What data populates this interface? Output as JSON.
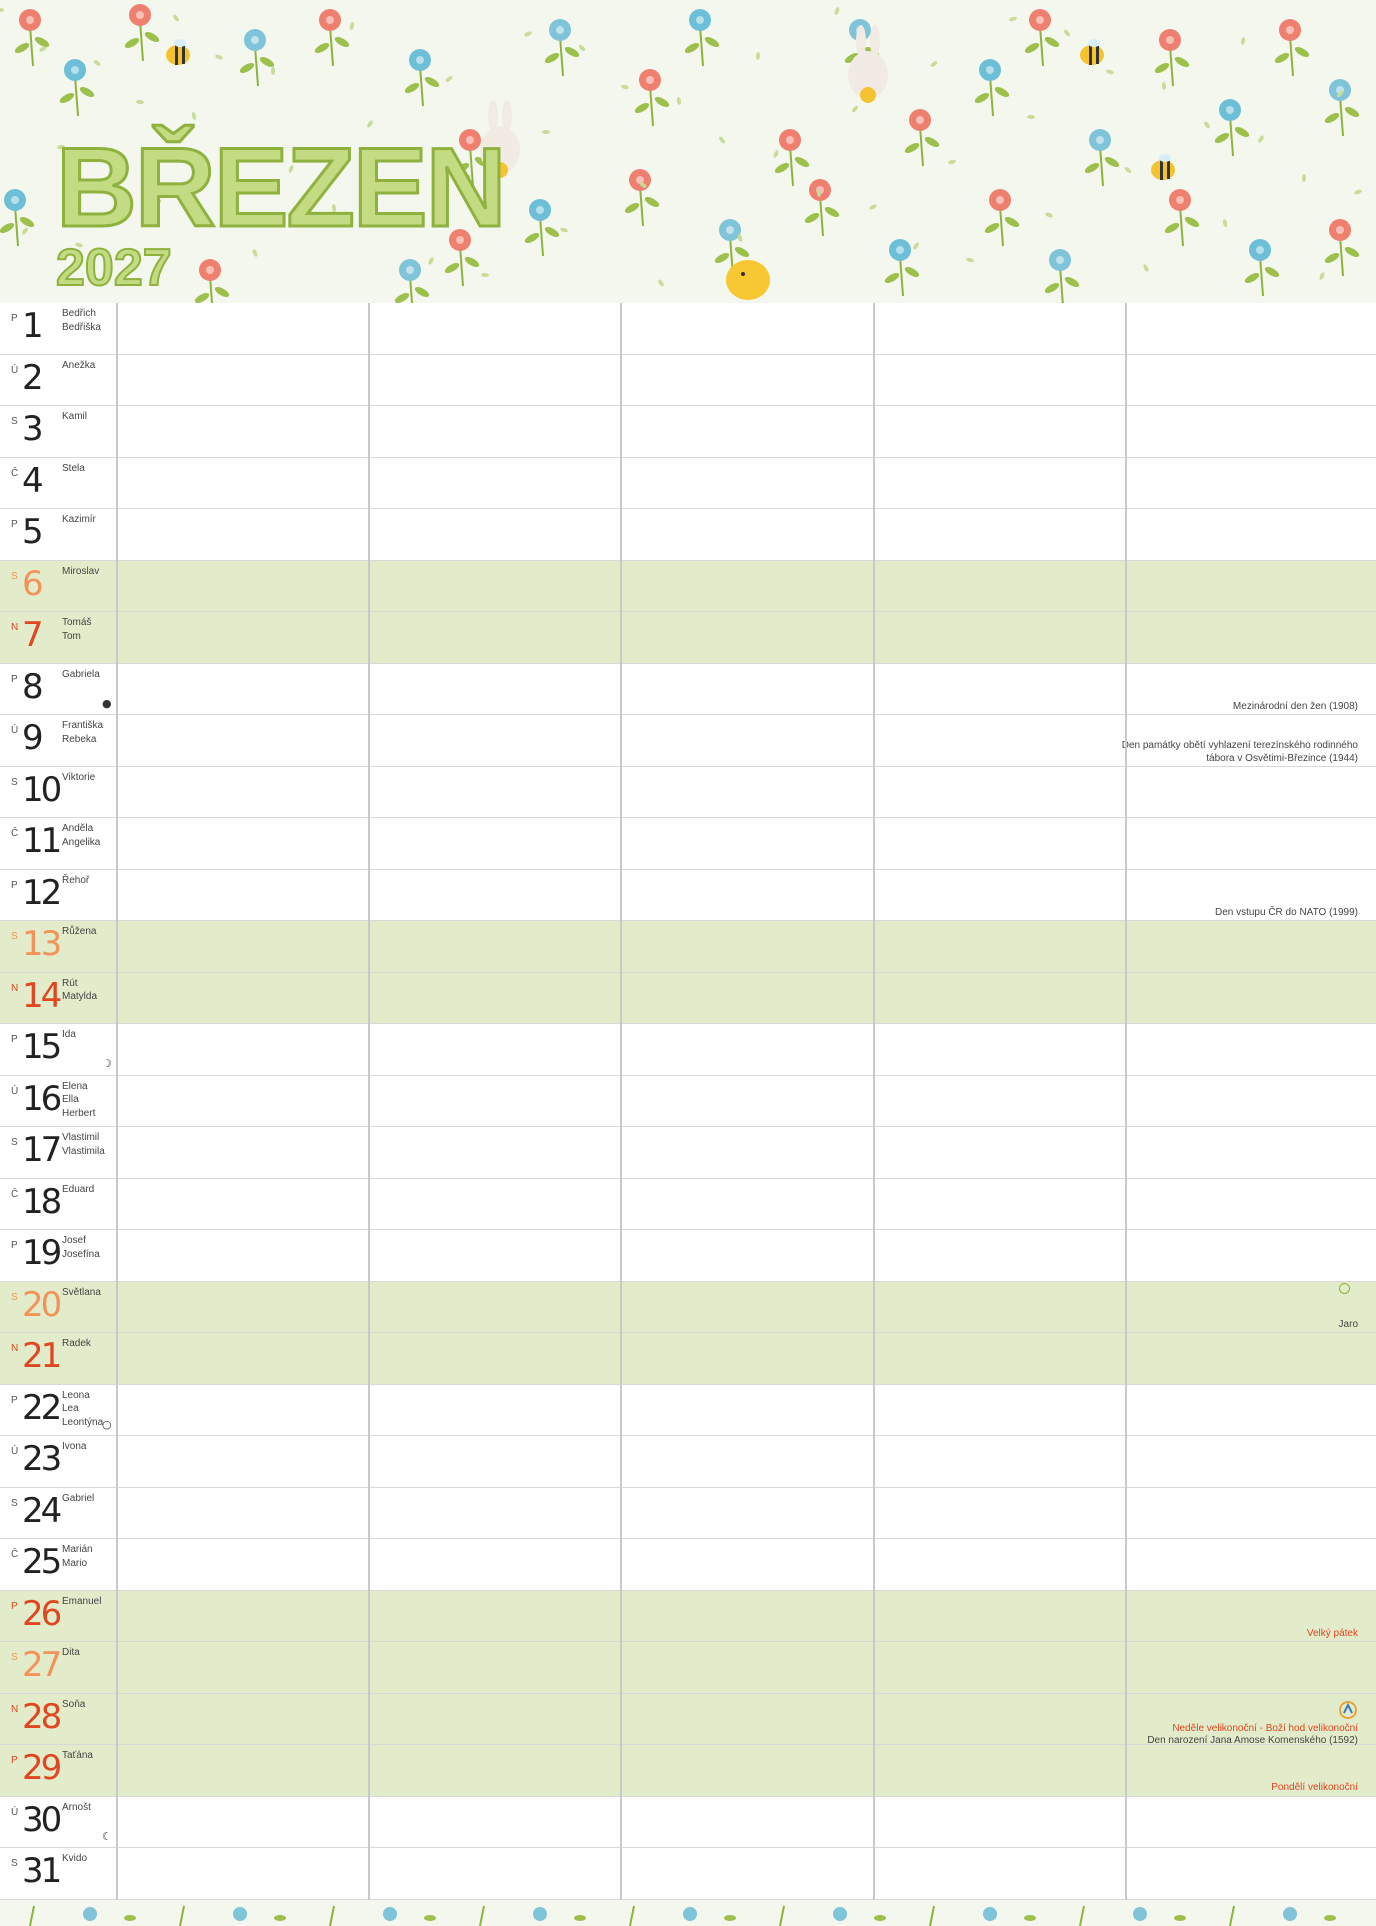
{
  "header": {
    "month": "BŘEZEN",
    "year": "2027"
  },
  "days": [
    {
      "dow": "P",
      "num": "1",
      "names": "Bedřich\nBedřiška",
      "type": "weekday"
    },
    {
      "dow": "Ú",
      "num": "2",
      "names": "Anežka",
      "type": "weekday"
    },
    {
      "dow": "S",
      "num": "3",
      "names": "Kamil",
      "type": "weekday"
    },
    {
      "dow": "Č",
      "num": "4",
      "names": "Stela",
      "type": "weekday"
    },
    {
      "dow": "P",
      "num": "5",
      "names": "Kazimír",
      "type": "weekday"
    },
    {
      "dow": "S",
      "num": "6",
      "names": "Miroslav",
      "type": "sat"
    },
    {
      "dow": "N",
      "num": "7",
      "names": "Tomáš\nTom",
      "type": "sun"
    },
    {
      "dow": "P",
      "num": "8",
      "names": "Gabriela",
      "type": "weekday",
      "moon": "●",
      "note": "Mezinárodní den žen (1908)"
    },
    {
      "dow": "Ú",
      "num": "9",
      "names": "Františka\nRebeka",
      "type": "weekday",
      "note": "Den památky obětí vyhlazení terezínského rodinného tábora v Osvětimi-Březince (1944)"
    },
    {
      "dow": "S",
      "num": "10",
      "names": "Viktorie",
      "type": "weekday"
    },
    {
      "dow": "Č",
      "num": "11",
      "names": "Anděla\nAngelika",
      "type": "weekday"
    },
    {
      "dow": "P",
      "num": "12",
      "names": "Řehoř",
      "type": "weekday",
      "note": "Den vstupu ČR do NATO (1999)"
    },
    {
      "dow": "S",
      "num": "13",
      "names": "Růžena",
      "type": "sat"
    },
    {
      "dow": "N",
      "num": "14",
      "names": "Rút\nMatylda",
      "type": "sun"
    },
    {
      "dow": "P",
      "num": "15",
      "names": "Ida",
      "type": "weekday",
      "moon": "☽"
    },
    {
      "dow": "Ú",
      "num": "16",
      "names": "Elena\nElla\nHerbert",
      "type": "weekday"
    },
    {
      "dow": "S",
      "num": "17",
      "names": "Vlastimil\nVlastimila",
      "type": "weekday"
    },
    {
      "dow": "Č",
      "num": "18",
      "names": "Eduard",
      "type": "weekday"
    },
    {
      "dow": "P",
      "num": "19",
      "names": "Josef\nJosefína",
      "type": "weekday"
    },
    {
      "dow": "S",
      "num": "20",
      "names": "Světlana",
      "type": "sat",
      "note": "Jaro",
      "note_style": "green"
    },
    {
      "dow": "N",
      "num": "21",
      "names": "Radek",
      "type": "sun"
    },
    {
      "dow": "P",
      "num": "22",
      "names": "Leona\nLea\nLeontýna",
      "type": "weekday",
      "moon": "○"
    },
    {
      "dow": "Ú",
      "num": "23",
      "names": "Ivona",
      "type": "weekday"
    },
    {
      "dow": "S",
      "num": "24",
      "names": "Gabriel",
      "type": "weekday"
    },
    {
      "dow": "Č",
      "num": "25",
      "names": "Marián\nMario",
      "type": "weekday"
    },
    {
      "dow": "P",
      "num": "26",
      "names": "Emanuel",
      "type": "holiday",
      "note": "Velký pátek",
      "note_style": "red"
    },
    {
      "dow": "S",
      "num": "27",
      "names": "Dita",
      "type": "sat"
    },
    {
      "dow": "N",
      "num": "28",
      "names": "Soňa",
      "type": "sun",
      "note_red": "Neděle velikonoční - Boží hod velikonoční",
      "note": "Den narození Jana Amose Komenského (1592)"
    },
    {
      "dow": "P",
      "num": "29",
      "names": "Taťána",
      "type": "holiday",
      "note": "Pondělí velikonoční",
      "note_style": "red"
    },
    {
      "dow": "Ú",
      "num": "30",
      "names": "Arnošt",
      "type": "weekday",
      "moon": "☾"
    },
    {
      "dow": "S",
      "num": "31",
      "names": "Kvido",
      "type": "weekday"
    }
  ],
  "colors": {
    "weekend_bg": "#e3ecca",
    "title_fill": "#c3dc83",
    "title_stroke": "#8fb13e",
    "sunday_red": "#e0461f",
    "saturday_orange": "#f2935a"
  }
}
